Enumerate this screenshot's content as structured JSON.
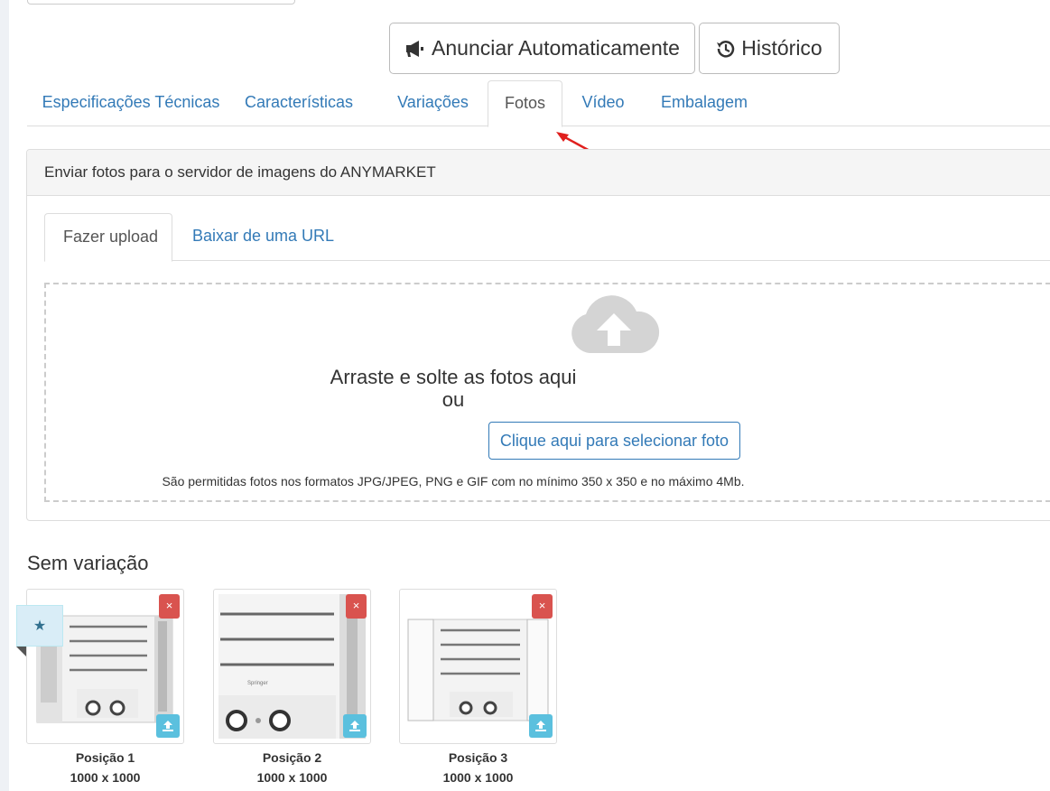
{
  "toolbar": {
    "anunciar_label": "Anunciar Automaticamente",
    "historico_label": "Histórico"
  },
  "tabs": [
    {
      "label": "Especificações Técnicas"
    },
    {
      "label": "Características"
    },
    {
      "label": "Variações"
    },
    {
      "label": "Fotos",
      "active": true
    },
    {
      "label": "Vídeo"
    },
    {
      "label": "Embalagem"
    }
  ],
  "panel": {
    "heading": "Enviar fotos para o servidor de imagens do ANYMARKET",
    "subtabs": [
      {
        "label": "Fazer upload",
        "active": true
      },
      {
        "label": "Baixar de uma URL"
      }
    ],
    "dropzone": {
      "line1": "Arraste e solte as fotos aqui",
      "line2": "ou",
      "button_label": "Clique aqui para selecionar foto",
      "hint": "São permitidas fotos nos formatos JPG/JPEG, PNG e GIF com no mínimo 350 x 350 e no máximo 4Mb."
    }
  },
  "photos": {
    "section_title": "Sem variação",
    "remove_label": "×",
    "items": [
      {
        "position_label": "Posição 1",
        "dimensions": "1000 x 1000",
        "primary": true
      },
      {
        "position_label": "Posição 2",
        "dimensions": "1000 x 1000"
      },
      {
        "position_label": "Posição 3",
        "dimensions": "1000 x 1000"
      }
    ]
  },
  "colors": {
    "link": "#337ab7",
    "danger": "#d9534f",
    "info": "#5bc0de",
    "annotation_arrow": "#e0201e"
  }
}
